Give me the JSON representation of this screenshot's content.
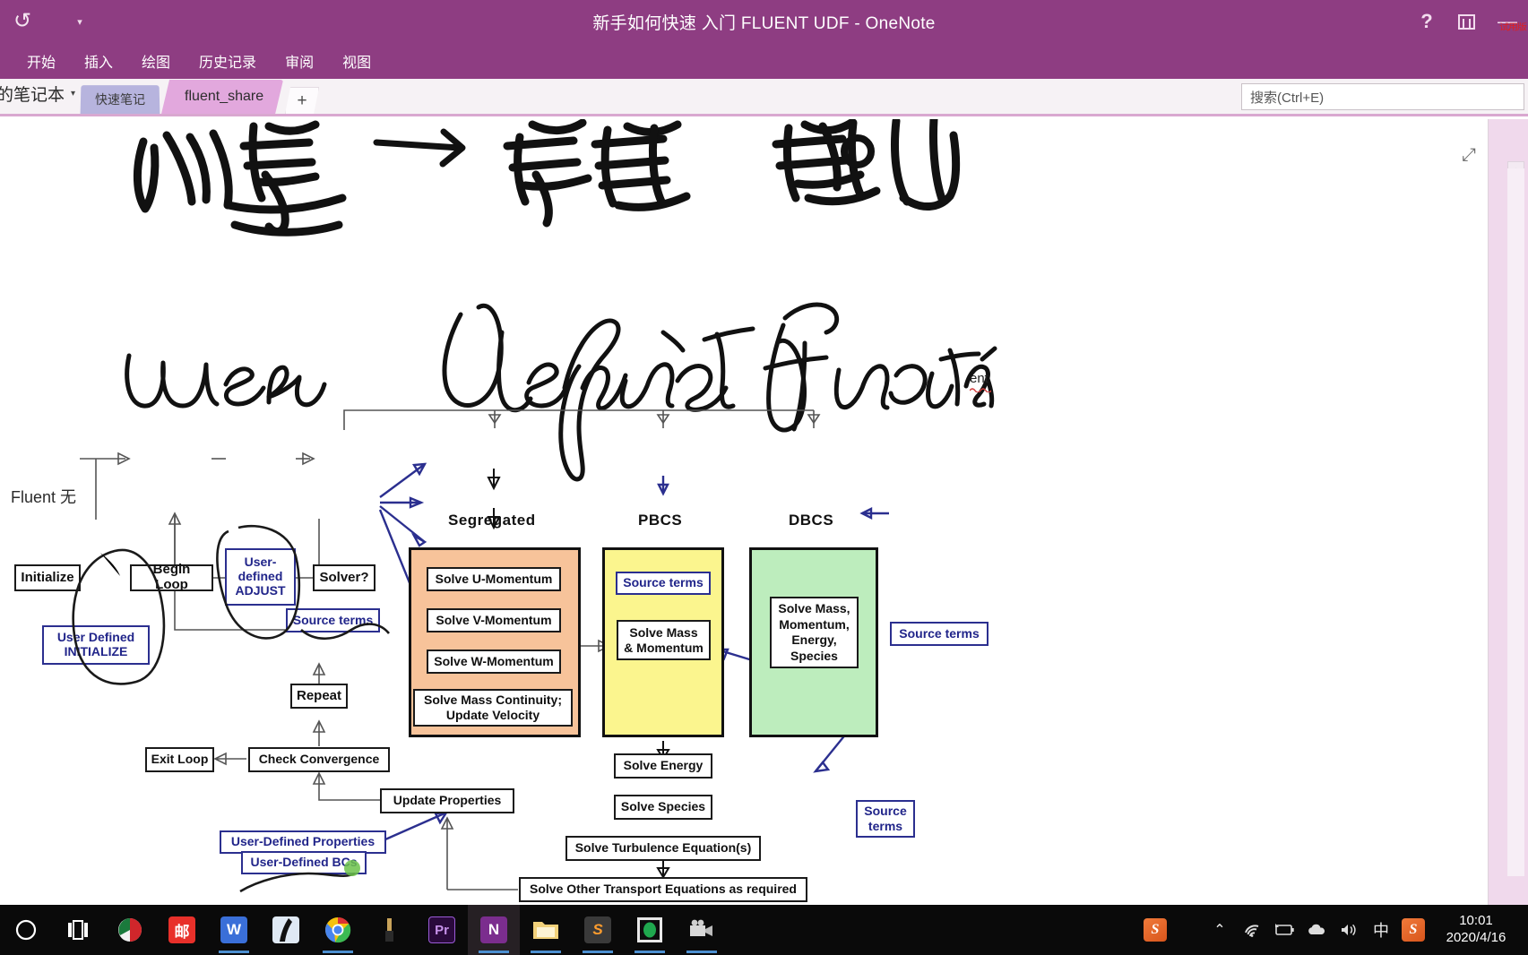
{
  "window": {
    "title": "新手如何快速 入门 FLUENT UDF - OneNote",
    "undo_icon": "undo-arrow-icon",
    "quick_access_caret": "chevron-down-icon",
    "help_label": "?",
    "ribbon_display_options": "ribbon-display-options-icon",
    "minimize_label": "—",
    "watermark": "试用版"
  },
  "ribbon": {
    "tabs": [
      {
        "label": "开始"
      },
      {
        "label": "插入"
      },
      {
        "label": "绘图"
      },
      {
        "label": "历史记录"
      },
      {
        "label": "审阅"
      },
      {
        "label": "视图"
      }
    ]
  },
  "notebook_bar": {
    "notebook_name": "的笔记本",
    "caret": "▾",
    "sections": [
      {
        "label": "快速笔记",
        "active": false
      },
      {
        "label": "fluent_share",
        "active": true
      }
    ],
    "add_section_label": "+",
    "search_placeholder": "搜索(Ctrl+E)"
  },
  "page": {
    "expand_icon": "expand-arrows-icon",
    "scroll_up_icon": "▲",
    "handwriting": [
      {
        "text": "流程 —> 锢陇 ...",
        "note": "ink-stroke-line-1"
      },
      {
        "text": "user defined function",
        "note": "ink-stroke-line-2"
      }
    ],
    "typed_text": "Fluent 无",
    "inline_word": "ent"
  },
  "flowchart": {
    "column_labels": [
      {
        "label": "Segregated"
      },
      {
        "label": "PBCS"
      },
      {
        "label": "DBCS"
      }
    ],
    "nodes": [
      {
        "id": "initialize",
        "label": "Initialize",
        "style": "black"
      },
      {
        "id": "begin-loop",
        "label": "Begin Loop",
        "style": "black"
      },
      {
        "id": "user-defined-adjust",
        "label": "User-\ndefined\nADJUST",
        "style": "blue"
      },
      {
        "id": "solver",
        "label": "Solver?",
        "style": "black"
      },
      {
        "id": "user-defined-initialize",
        "label": "User Defined\nINITIALIZE",
        "style": "blue"
      },
      {
        "id": "source-terms-left",
        "label": "Source terms",
        "style": "blue"
      },
      {
        "id": "solve-u-momentum",
        "label": "Solve U-Momentum",
        "style": "black"
      },
      {
        "id": "solve-v-momentum",
        "label": "Solve V-Momentum",
        "style": "black"
      },
      {
        "id": "solve-w-momentum",
        "label": "Solve W-Momentum",
        "style": "black"
      },
      {
        "id": "solve-mass-continuity",
        "label": "Solve Mass Continuity;\nUpdate Velocity",
        "style": "black"
      },
      {
        "id": "source-terms-pbcs",
        "label": "Source terms",
        "style": "blue"
      },
      {
        "id": "solve-mass-momentum",
        "label": "Solve Mass\n& Momentum",
        "style": "black"
      },
      {
        "id": "solve-mass-mom-energy-species",
        "label": "Solve Mass,\nMomentum,\nEnergy,\nSpecies",
        "style": "black"
      },
      {
        "id": "source-terms-dbcs",
        "label": "Source terms",
        "style": "blue"
      },
      {
        "id": "repeat",
        "label": "Repeat",
        "style": "black"
      },
      {
        "id": "exit-loop",
        "label": "Exit Loop",
        "style": "black"
      },
      {
        "id": "check-convergence",
        "label": "Check Convergence",
        "style": "black"
      },
      {
        "id": "update-properties",
        "label": "Update Properties",
        "style": "black"
      },
      {
        "id": "user-defined-properties",
        "label": "User-Defined Properties",
        "style": "blue"
      },
      {
        "id": "user-defined-bcs",
        "label": "User-Defined BCs",
        "style": "blue"
      },
      {
        "id": "solve-energy",
        "label": "Solve Energy",
        "style": "black"
      },
      {
        "id": "solve-species",
        "label": "Solve Species",
        "style": "black"
      },
      {
        "id": "solve-turbulence",
        "label": "Solve Turbulence Equation(s)",
        "style": "black"
      },
      {
        "id": "solve-other-transport",
        "label": "Solve Other Transport Equations as required",
        "style": "black"
      },
      {
        "id": "source-terms-right",
        "label": "Source\nterms",
        "style": "blue"
      }
    ],
    "colors": {
      "segregated_fill": "#f7c39a",
      "pbcs_fill": "#fbf58e",
      "dbcs_fill": "#bdedbd",
      "udf_blue": "#21258a",
      "line_black": "#111111"
    }
  },
  "taskbar": {
    "items": [
      {
        "name": "cortana-icon",
        "label": "O"
      },
      {
        "name": "task-view-icon",
        "label": "▤"
      },
      {
        "name": "browser-icon",
        "label": ""
      },
      {
        "name": "red-app-icon",
        "label": "邮"
      },
      {
        "name": "wps-writer-icon",
        "label": "W"
      },
      {
        "name": "dark-app-icon",
        "label": ""
      },
      {
        "name": "chrome-icon",
        "label": ""
      },
      {
        "name": "tool-icon",
        "label": ""
      },
      {
        "name": "premiere-icon",
        "label": "Pr"
      },
      {
        "name": "onenote-icon",
        "label": "N"
      },
      {
        "name": "file-explorer-icon",
        "label": ""
      },
      {
        "name": "sublime-icon",
        "label": "S"
      },
      {
        "name": "qq-icon",
        "label": ""
      },
      {
        "name": "camera-icon",
        "label": ""
      }
    ],
    "tray": [
      {
        "name": "snipaste-icon",
        "label": "S"
      },
      {
        "name": "show-hidden-icons-chevron",
        "label": "⌃"
      },
      {
        "name": "wifi-icon",
        "label": ""
      },
      {
        "name": "battery-icon",
        "label": ""
      },
      {
        "name": "cloud-icon",
        "label": ""
      },
      {
        "name": "volume-icon",
        "label": ""
      },
      {
        "name": "ime-chinese-icon",
        "label": "中"
      },
      {
        "name": "sogou-icon",
        "label": "S"
      }
    ],
    "clock_time": "10:01",
    "clock_date": "2020/4/16"
  }
}
